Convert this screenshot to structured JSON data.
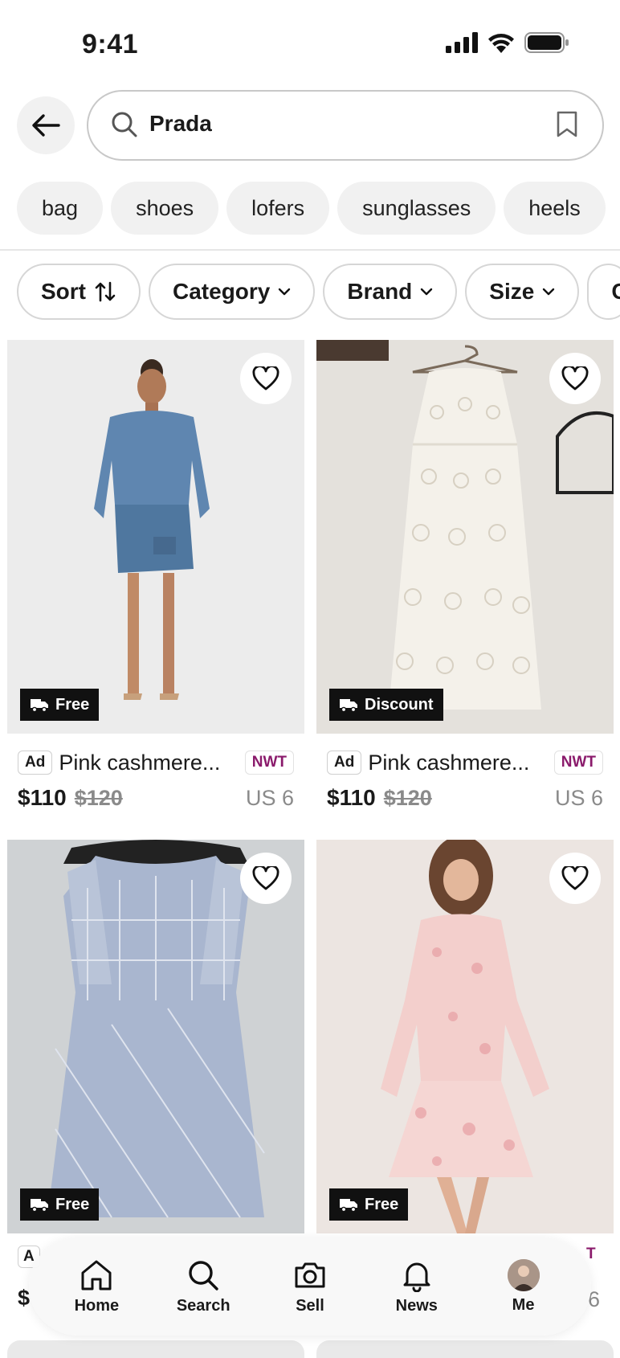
{
  "status_bar": {
    "time": "9:41"
  },
  "search": {
    "query": "Prada"
  },
  "suggestions": [
    "bag",
    "shoes",
    "lofers",
    "sunglasses",
    "heels"
  ],
  "filters": [
    {
      "label": "Sort",
      "icon": "sort-arrows-icon"
    },
    {
      "label": "Category",
      "icon": "chevron-down-icon"
    },
    {
      "label": "Brand",
      "icon": "chevron-down-icon"
    },
    {
      "label": "Size",
      "icon": "chevron-down-icon"
    },
    {
      "label": "C",
      "icon": ""
    }
  ],
  "products": [
    {
      "ad": "Ad",
      "title": "Pink cashmere...",
      "condition": "NWT",
      "price": "$110",
      "original_price": "$120",
      "size": "US 6",
      "shipping": "Free"
    },
    {
      "ad": "Ad",
      "title": "Pink cashmere...",
      "condition": "NWT",
      "price": "$110",
      "original_price": "$120",
      "size": "US 6",
      "shipping": "Discount"
    },
    {
      "shipping": "Free"
    },
    {
      "shipping": "Free"
    }
  ],
  "peek": {
    "left_ad": "A",
    "left_price": "$",
    "right_badge": "T",
    "right_size": "6"
  },
  "nav": {
    "home": "Home",
    "search": "Search",
    "sell": "Sell",
    "news": "News",
    "me": "Me"
  },
  "colors": {
    "nwt": "#8a1a6b",
    "badge_bg": "#111111",
    "chip_bg": "#f1f1f1"
  }
}
